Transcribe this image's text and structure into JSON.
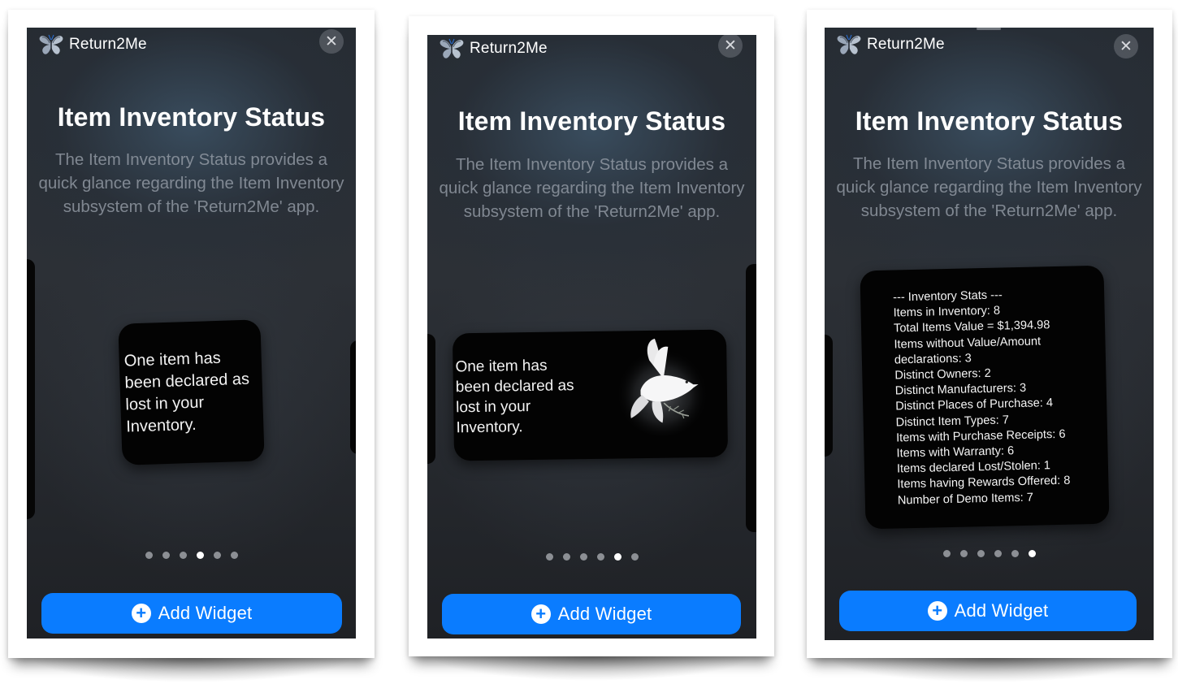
{
  "header": {
    "app_name": "Return2Me",
    "close_glyph": "✕"
  },
  "title": "Item Inventory Status",
  "description": "The Item Inventory Status provides a quick glance regarding the Item Inventory subsystem of the 'Return2Me' app.",
  "add_widget_label": "Add Widget",
  "add_icon": "plus-circle-icon",
  "app_icon": "butterfly-icon",
  "widget_image": "dove-icon",
  "widget_message": "One item has been declared as lost in your Inventory.",
  "widget_message_lines": [
    "One item has",
    "been declared as",
    "lost in your",
    "Inventory."
  ],
  "stats_lines": [
    "--- Inventory Stats ---",
    "Items in Inventory: 8",
    "Total Items Value = $1,394.98",
    "Items without Value/Amount",
    "declarations: 3",
    "Distinct Owners: 2",
    "Distinct Manufacturers: 3",
    "Distinct Places of Purchase: 4",
    "Distinct Item Types: 7",
    "Items with Purchase Receipts: 6",
    "Items with Warranty: 6",
    "Items declared Lost/Stolen: 1",
    "Items having Rewards Offered: 8",
    "Number of Demo Items: 7"
  ],
  "page_count": 6,
  "screens": [
    {
      "id": "screen-1",
      "widget_style": "text-small",
      "active_page": 4
    },
    {
      "id": "screen-2",
      "widget_style": "text-with-image",
      "active_page": 5
    },
    {
      "id": "screen-3",
      "widget_style": "stats-large",
      "active_page": 6
    }
  ],
  "colors": {
    "accent": "#0a7cff",
    "background": "#262b31",
    "widget": "#030303",
    "description": "#969ea8"
  }
}
